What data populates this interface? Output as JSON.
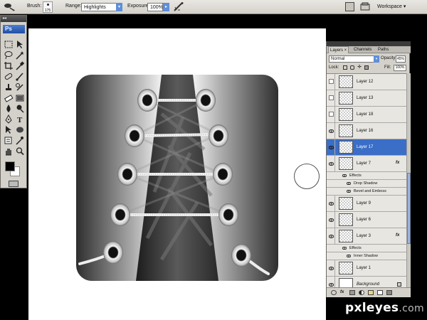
{
  "options_bar": {
    "brush_label": "Brush:",
    "brush_size": "175",
    "range_label": "Range:",
    "range_value": "Highlights",
    "exposure_label": "Exposure:",
    "exposure_value": "100%",
    "workspace_label": "Workspace"
  },
  "toolbox": {
    "logo": "Ps",
    "collapse_label": "◂◂",
    "foreground_color": "#000000",
    "background_color": "#ffffff"
  },
  "layers_panel": {
    "tabs": [
      {
        "label": "Layers ×",
        "active": true
      },
      {
        "label": "Channels",
        "active": false
      },
      {
        "label": "Paths",
        "active": false
      }
    ],
    "blend_mode": "Normal",
    "opacity_label": "Opacity:",
    "opacity_value": "45%",
    "lock_label": "Lock:",
    "fill_label": "Fill:",
    "fill_value": "100%",
    "layers": [
      {
        "name": "Layer 12",
        "visible": false
      },
      {
        "name": "Layer 13",
        "visible": false
      },
      {
        "name": "Layer 18",
        "visible": false
      },
      {
        "name": "Layer 16",
        "visible": true
      },
      {
        "name": "Layer 17",
        "visible": true,
        "selected": true
      },
      {
        "name": "Layer 7",
        "visible": true,
        "fx": true
      },
      {
        "name": "Layer 9",
        "visible": true
      },
      {
        "name": "Layer 6",
        "visible": true
      },
      {
        "name": "Layer 3",
        "visible": true,
        "fx": true
      },
      {
        "name": "Layer 1",
        "visible": true
      },
      {
        "name": "Background",
        "visible": true,
        "locked": true
      }
    ],
    "effects_label": "Effects",
    "fx_badge": "fx",
    "layer7_effects": [
      "Drop Shadow",
      "Bevel and Emboss"
    ],
    "layer3_effects": [
      "Inner Shadow"
    ]
  },
  "watermark": {
    "brand": "pxleyes",
    "domain": ".com"
  },
  "colors": {
    "selection_blue": "#3a6ec7",
    "panel_gray": "#d4d1ca"
  }
}
